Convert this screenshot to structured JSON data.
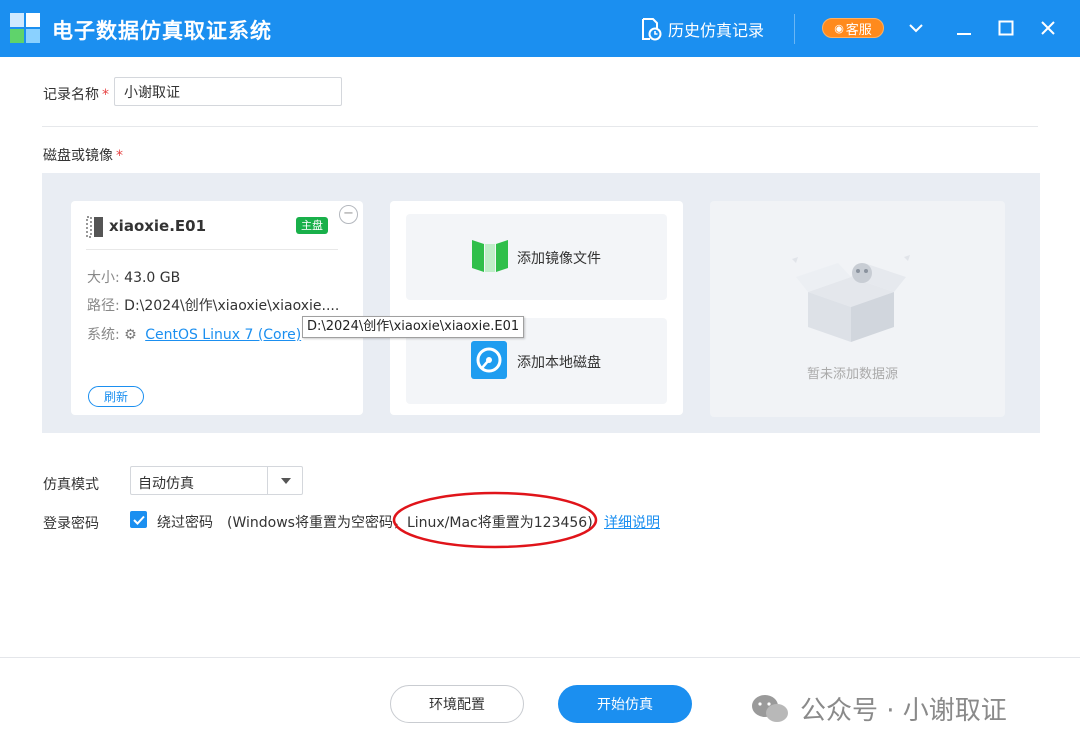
{
  "titlebar": {
    "app_title": "电子数据仿真取证系统",
    "history_label": "历史仿真记录",
    "service_label": "客服",
    "icons": [
      "app-logo",
      "history-icon",
      "headset-icon",
      "chevron-down-icon",
      "minimize-icon",
      "maximize-icon",
      "close-icon"
    ]
  },
  "form": {
    "record_name_label": "记录名称",
    "required_mark": "*",
    "record_name_value": "小谢取证",
    "disk_label": "磁盘或镜像"
  },
  "disk_card": {
    "name": "xiaoxie.E01",
    "badge": "主盘",
    "remove_symbol": "−",
    "size_label": "大小:",
    "size_value": "43.0 GB",
    "path_label": "路径:",
    "path_value": "D:\\2024\\创作\\xiaoxie\\xiaoxie....",
    "system_label": "系统:",
    "system_value": "CentOS Linux 7 (Core)",
    "refresh_label": "刷新"
  },
  "tooltip": "D:\\2024\\创作\\xiaoxie\\xiaoxie.E01",
  "add_card": {
    "add_image_label": "添加镜像文件",
    "add_local_disk_label": "添加本地磁盘"
  },
  "empty_card": {
    "text": "暂未添加数据源"
  },
  "sim_mode": {
    "label": "仿真模式",
    "selected": "自动仿真"
  },
  "login_password": {
    "label": "登录密码",
    "checkbox_checked": true,
    "checkbox_label": "绕过密码",
    "note": "(Windows将重置为空密码，Linux/Mac将重置为123456)",
    "detail_link": "详细说明"
  },
  "footer": {
    "env_config_label": "环境配置",
    "start_label": "开始仿真"
  },
  "watermark": {
    "text": "公众号 · 小谢取证"
  },
  "colors": {
    "accent": "#1b8ff0",
    "service": "#ff8a1d",
    "badge_green": "#19b04a",
    "required_red": "#e64343",
    "annotation_red": "#e0141a"
  }
}
